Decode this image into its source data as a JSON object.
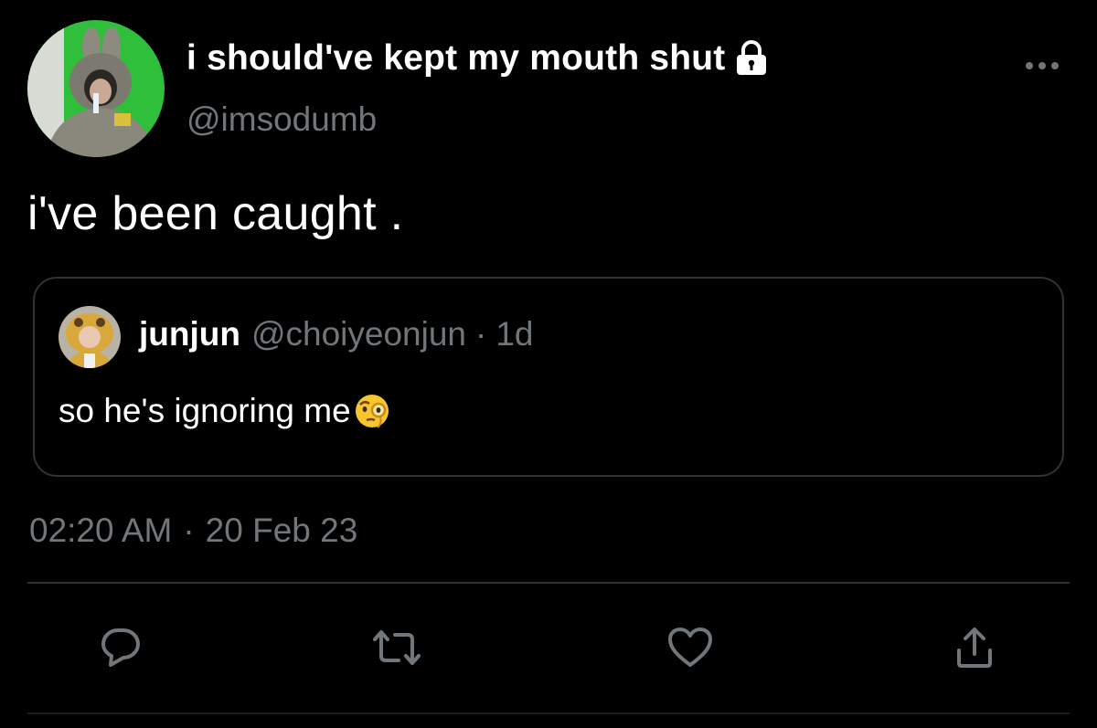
{
  "tweet": {
    "author": {
      "display_name": "i should've kept my mouth shut",
      "handle": "@imsodumb",
      "protected_icon": "lock-icon"
    },
    "text": "i've been caught .",
    "more_icon": "more-horizontal-icon",
    "quoted": {
      "author_name": "junjun",
      "author_handle": "@choiyeonjun",
      "separator": "·",
      "time": "1d",
      "text": "so he's ignoring me",
      "emoji_icon": "face-with-monocle-icon"
    },
    "timestamp": {
      "time": "02:20 AM",
      "separator": "·",
      "date": "20 Feb 23"
    },
    "actions": [
      {
        "name": "reply",
        "icon": "reply-icon"
      },
      {
        "name": "retweet",
        "icon": "retweet-icon"
      },
      {
        "name": "like",
        "icon": "heart-icon"
      },
      {
        "name": "share",
        "icon": "share-icon"
      }
    ]
  },
  "colors": {
    "background": "#000000",
    "primary_text": "#ffffff",
    "secondary_text": "#71767b",
    "border": "#2f3336"
  }
}
